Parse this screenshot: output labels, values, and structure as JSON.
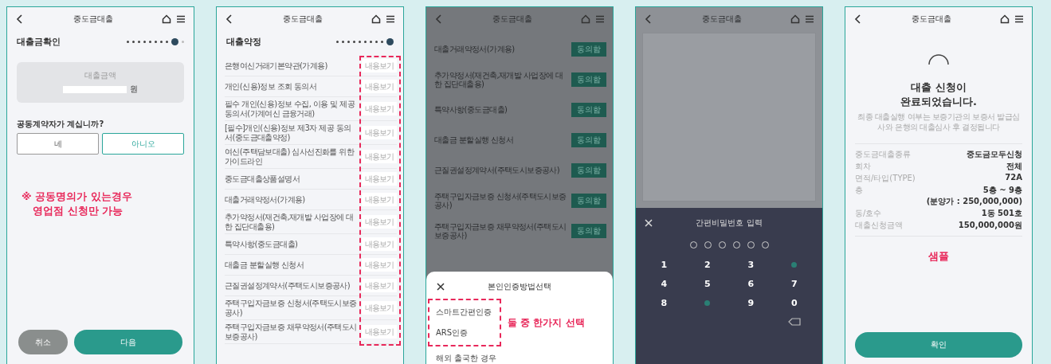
{
  "screens": [
    {
      "kind": "amount_confirm",
      "title": "중도금대출",
      "heading": "대출금확인",
      "steps": [
        {
          "done": true,
          "current": false
        },
        {
          "done": true,
          "current": false
        },
        {
          "done": true,
          "current": false
        },
        {
          "done": true,
          "current": false
        },
        {
          "done": true,
          "current": false
        },
        {
          "done": true,
          "current": false
        },
        {
          "done": true,
          "current": false
        },
        {
          "done": true,
          "current": false
        },
        {
          "done": false,
          "current": true
        },
        {
          "done": false,
          "current": false
        }
      ],
      "amount_label": "대출금액",
      "amount_unit": "원",
      "question": "공동계약자가 계십니까?",
      "options": [
        {
          "label": "네",
          "selected": false
        },
        {
          "label": "아니오",
          "selected": true
        }
      ],
      "note_lines": [
        "※ 공동명의가 있는경우",
        "영업점 신청만 가능"
      ],
      "buttons": [
        {
          "label": "취소",
          "kind": "secondary"
        },
        {
          "label": "다음",
          "kind": "primary"
        }
      ]
    },
    {
      "kind": "agreement_list",
      "title": "중도금대출",
      "heading": "대출약정",
      "steps": [
        {
          "done": true,
          "current": false
        },
        {
          "done": true,
          "current": false
        },
        {
          "done": true,
          "current": false
        },
        {
          "done": true,
          "current": false
        },
        {
          "done": true,
          "current": false
        },
        {
          "done": true,
          "current": false
        },
        {
          "done": true,
          "current": false
        },
        {
          "done": true,
          "current": false
        },
        {
          "done": true,
          "current": false
        },
        {
          "done": false,
          "current": true
        }
      ],
      "items": [
        {
          "label": "은행여신거래기본약관(가계용)",
          "action": "내용보기"
        },
        {
          "label": "개인(신용)정보 조회 동의서",
          "action": "내용보기"
        },
        {
          "label": "필수 개인(신용)정보 수집, 이용 및 제공 동의서(가계여신 금융거래)",
          "action": "내용보기"
        },
        {
          "label": "[필수]개인(신용)정보 제3자 제공 동의서(중도금대출약정)",
          "action": "내용보기"
        },
        {
          "label": "여신(주택담보대출) 심사선진화를 위한 가이드라인",
          "action": "내용보기"
        },
        {
          "label": "중도금대출상품설명서",
          "action": "내용보기"
        },
        {
          "label": "대출거래약정서(가계용)",
          "action": "내용보기"
        },
        {
          "label": "추가약정서(재건축,재개발 사업장에 대한 집단대출용)",
          "action": "내용보기"
        },
        {
          "label": "특약사항(중도금대출)",
          "action": "내용보기"
        },
        {
          "label": "대출금 분할실행 신청서",
          "action": "내용보기"
        },
        {
          "label": "근질권설정계약서(주택도시보증공사)",
          "action": "내용보기"
        },
        {
          "label": "주택구입자금보증 신청서(주택도시보증공사)",
          "action": "내용보기"
        },
        {
          "label": "주택구입자금보증 채무약정서(주택도시보증공사)",
          "action": "내용보기"
        }
      ]
    },
    {
      "kind": "auth_select",
      "title": "중도금대출",
      "items": [
        {
          "label": "대출거래약정서(가계용)",
          "action": "동의함"
        },
        {
          "label": "추가약정서(재건축,재개발 사업장에 대한 집단대출용)",
          "action": "동의함"
        },
        {
          "label": "특약사항(중도금대출)",
          "action": "동의함"
        },
        {
          "label": "대출금 분할실행 신청서",
          "action": "동의함"
        },
        {
          "label": "근질권설정계약서(주택도시보증공사)",
          "action": "동의함"
        },
        {
          "label": "주택구입자금보증 신청서(주택도시보증공사)",
          "action": "동의함"
        },
        {
          "label": "주택구입자금보증 채무약정서(주택도시보증공사)",
          "action": "동의함"
        }
      ],
      "sheet": {
        "title": "본인인증방법선택",
        "options": [
          "스마트간편인증",
          "ARS인증"
        ],
        "other": "해외 출국한 경우",
        "note": "둘 중 한가지 선택"
      }
    },
    {
      "kind": "pin_entry",
      "title": "중도금대출",
      "pad_title": "간편비밀번호 입력",
      "pin_slots": [
        {
          "filled": false
        },
        {
          "filled": false
        },
        {
          "filled": false
        },
        {
          "filled": false
        },
        {
          "filled": false
        },
        {
          "filled": false
        }
      ],
      "keys": [
        {
          "kind": "digit",
          "label": "1"
        },
        {
          "kind": "digit",
          "label": "2"
        },
        {
          "kind": "digit",
          "label": "3"
        },
        {
          "kind": "marker"
        },
        {
          "kind": "digit",
          "label": "4"
        },
        {
          "kind": "digit",
          "label": "5"
        },
        {
          "kind": "digit",
          "label": "6"
        },
        {
          "kind": "digit",
          "label": "7"
        },
        {
          "kind": "digit",
          "label": "8"
        },
        {
          "kind": "marker"
        },
        {
          "kind": "digit",
          "label": "9"
        },
        {
          "kind": "digit",
          "label": "0"
        },
        {
          "kind": "blank"
        },
        {
          "kind": "blank"
        },
        {
          "kind": "blank"
        },
        {
          "kind": "backspace"
        }
      ]
    },
    {
      "kind": "complete",
      "title": "중도금대출",
      "headline": [
        "대출 신청이",
        "완료되었습니다."
      ],
      "subtext": "최종 대출실행 여부는 보증기관의 보증서 발급심사와 은행의 대출심사 후 결정됩니다",
      "details": [
        {
          "label": "중도금대출종류",
          "values": [
            "중도금모두신청"
          ]
        },
        {
          "label": "회차",
          "values": [
            "전체"
          ]
        },
        {
          "label": "면적/타입(TYPE)",
          "values": [
            "72A"
          ]
        },
        {
          "label": "층",
          "values": [
            "5층 ~ 9층",
            "(분양가 : 250,000,000)"
          ]
        },
        {
          "label": "동/호수",
          "values": [
            "1동 501호"
          ]
        },
        {
          "label": "대출신청금액",
          "values": [
            "150,000,000원"
          ]
        }
      ],
      "stamp": "샘플",
      "button": "확인"
    }
  ]
}
